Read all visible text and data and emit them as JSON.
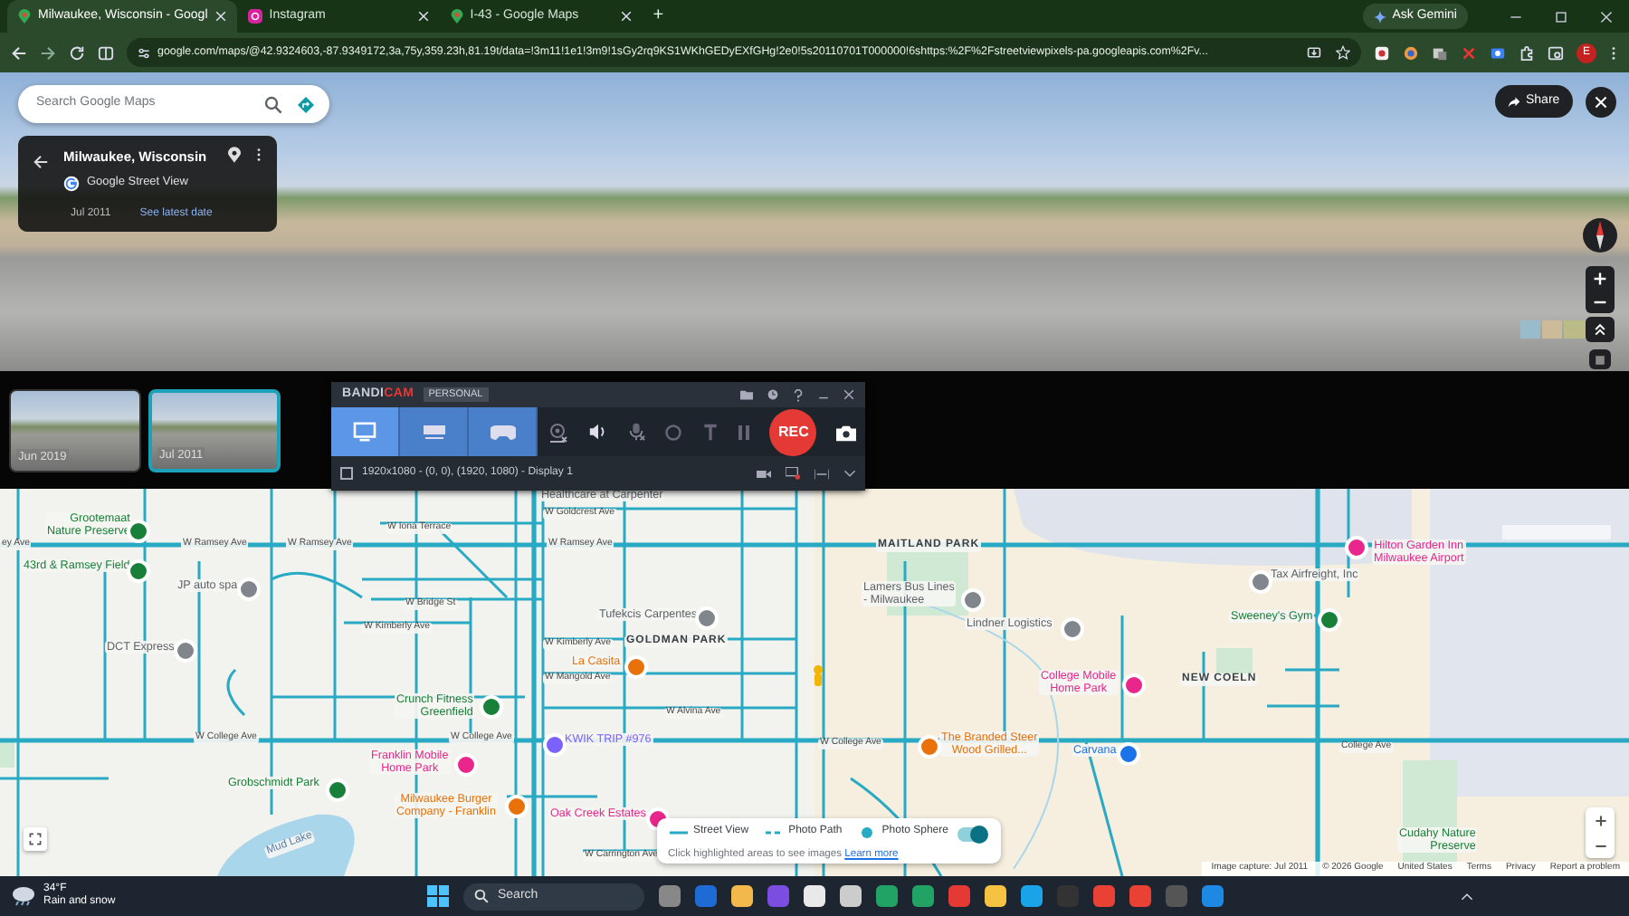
{
  "browser": {
    "tabs": [
      {
        "title": "Milwaukee, Wisconsin - Googl",
        "selected": true
      },
      {
        "title": "Instagram",
        "selected": false
      },
      {
        "title": "I-43 - Google Maps",
        "selected": false
      }
    ],
    "new_tab": "+",
    "gemini": "Ask Gemini",
    "profile_initial": "E",
    "url": "google.com/maps/@42.9324603,-87.9349172,3a,75y,359.23h,81.19t/data=!3m11!1e1!3m9!1sGy2rq9KS1WKhGEDyEXfGHg!2e0!5s20110701T000000!6shttps:%2F%2Fstreetviewpixels-pa.googleapis.com%2Fv..."
  },
  "street_view": {
    "search": {
      "placeholder": "Search Google Maps"
    },
    "place": {
      "title": "Milwaukee, Wisconsin",
      "source": "Google Street View",
      "date": "Jul 2011",
      "link": "See latest date"
    },
    "share": "Share",
    "timeline": [
      {
        "date": "Jun 2019",
        "selected": false
      },
      {
        "date": "Jul 2011",
        "selected": true
      }
    ]
  },
  "recorder": {
    "logo_first": "BANDI",
    "logo_second": "CAM",
    "edition": "PERSONAL",
    "modes": [
      {
        "kind": "screen",
        "selected": true
      },
      {
        "kind": "device",
        "selected": false
      },
      {
        "kind": "game",
        "selected": false
      }
    ],
    "rec": "REC",
    "area_checked": false,
    "area": "1920x1080 - (0, 0), (1920, 1080) - Display 1"
  },
  "map": {
    "labels": [
      {
        "kind": "business",
        "lines": [
          "Healthcare at Carpenter"
        ]
      },
      {
        "kind": "park",
        "lines": [
          "Grootemaat",
          "Nature Preserve"
        ]
      },
      {
        "kind": "park",
        "lines": [
          "43rd & Ramsey Field"
        ]
      },
      {
        "kind": "business",
        "lines": [
          "JP auto spa"
        ]
      },
      {
        "kind": "business",
        "lines": [
          "DCT Express"
        ]
      },
      {
        "kind": "park",
        "lines": [
          "Crunch Fitness",
          "Greenfield"
        ]
      },
      {
        "kind": "lodging",
        "lines": [
          "Franklin Mobile",
          "Home Park"
        ]
      },
      {
        "kind": "park",
        "lines": [
          "Grobschmidt Park"
        ]
      },
      {
        "kind": "food",
        "lines": [
          "Milwaukee Burger",
          "Company - Franklin"
        ]
      },
      {
        "kind": "lodging",
        "lines": [
          "Oak Creek Estates"
        ]
      },
      {
        "kind": "water",
        "lines": [
          "Mud Lake"
        ]
      },
      {
        "kind": "business",
        "lines": [
          "Tufekcis Carpentes"
        ]
      },
      {
        "kind": "area",
        "lines": [
          "GOLDMAN PARK"
        ]
      },
      {
        "kind": "food",
        "lines": [
          "La Casita"
        ]
      },
      {
        "kind": "gas",
        "lines": [
          "KWIK TRIP #976"
        ]
      },
      {
        "kind": "area",
        "lines": [
          "MAITLAND PARK"
        ]
      },
      {
        "kind": "business",
        "lines": [
          "Lamers Bus Lines",
          "- Milwaukee"
        ]
      },
      {
        "kind": "business",
        "lines": [
          "Lindner Logistics"
        ]
      },
      {
        "kind": "lodging",
        "lines": [
          "College Mobile",
          "Home Park"
        ]
      },
      {
        "kind": "area",
        "lines": [
          "NEW COELN"
        ]
      },
      {
        "kind": "lodging",
        "lines": [
          "Hilton Garden Inn",
          "Milwaukee Airport"
        ]
      },
      {
        "kind": "business",
        "lines": [
          "Tax Airfreight, Inc"
        ]
      },
      {
        "kind": "park",
        "lines": [
          "Sweeney's Gym"
        ]
      },
      {
        "kind": "food",
        "lines": [
          "The Branded Steer",
          "Wood Grilled..."
        ]
      },
      {
        "kind": "shop",
        "lines": [
          "Carvana"
        ]
      },
      {
        "kind": "park",
        "lines": [
          "Cudahy Nature",
          "Preserve"
        ]
      },
      {
        "kind": "street",
        "lines": [
          "ey Ave"
        ]
      },
      {
        "kind": "street",
        "lines": [
          "W Ramsey Ave"
        ]
      },
      {
        "kind": "street",
        "lines": [
          "W Ramsey Ave"
        ]
      },
      {
        "kind": "street",
        "lines": [
          "W Ramsey Ave"
        ]
      },
      {
        "kind": "street",
        "lines": [
          "W College Ave"
        ]
      },
      {
        "kind": "street",
        "lines": [
          "W College Ave"
        ]
      },
      {
        "kind": "street",
        "lines": [
          "W College Ave"
        ]
      },
      {
        "kind": "street",
        "lines": [
          "College Ave"
        ]
      },
      {
        "kind": "street",
        "lines": [
          "W Kimberly Ave"
        ]
      },
      {
        "kind": "street",
        "lines": [
          "W Mangold Ave"
        ]
      },
      {
        "kind": "street",
        "lines": [
          "W Alvina Ave"
        ]
      },
      {
        "kind": "street",
        "lines": [
          "W Goldcrest Ave"
        ]
      },
      {
        "kind": "street",
        "lines": [
          "W Iona Terrace"
        ]
      },
      {
        "kind": "street",
        "lines": [
          "W Bridge St"
        ]
      },
      {
        "kind": "street",
        "lines": [
          "W Kimberly Ave"
        ]
      },
      {
        "kind": "street",
        "lines": [
          "W Carrington Ave"
        ]
      }
    ],
    "legend": {
      "items": [
        {
          "kind": "line",
          "text": "Street View"
        },
        {
          "kind": "dashed",
          "text": "Photo Path"
        },
        {
          "kind": "dot",
          "text": "Photo Sphere"
        }
      ],
      "toggle_on": true,
      "hint": "Click highlighted areas to see images",
      "link": "Learn more"
    },
    "attribution": [
      "Image capture: Jul 2011",
      "© 2026 Google",
      "United States",
      "Terms",
      "Privacy",
      "Report a problem"
    ]
  },
  "taskbar": {
    "temperature": "34°F",
    "weather": "Rain and snow",
    "search": "Search"
  }
}
